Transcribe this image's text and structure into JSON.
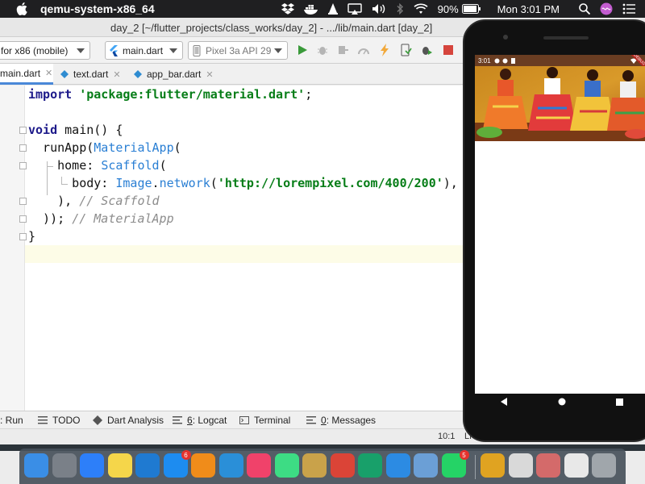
{
  "menubar": {
    "app_name": "qemu-system-x86_64",
    "battery": "90%",
    "clock": "Mon 3:01 PM"
  },
  "window": {
    "title": "day_2 [~/flutter_projects/class_works/day_2] - .../lib/main.dart [day_2]"
  },
  "toolbar": {
    "device_target": "for x86 (mobile)",
    "run_config": "main.dart",
    "emulator_device": "Pixel 3a API 29"
  },
  "tabs": [
    {
      "label": "main.dart",
      "active": true
    },
    {
      "label": "text.dart",
      "active": false
    },
    {
      "label": "app_bar.dart",
      "active": false
    }
  ],
  "editor": {
    "lines": [
      {
        "parts": [
          {
            "t": "import ",
            "c": "kw"
          },
          {
            "t": "'package:flutter/material.dart'",
            "c": "str"
          },
          {
            "t": ";",
            "c": ""
          }
        ]
      },
      {
        "parts": []
      },
      {
        "parts": [
          {
            "t": "void ",
            "c": "kw"
          },
          {
            "t": "main() {",
            "c": ""
          }
        ]
      },
      {
        "parts": [
          {
            "t": "  runApp(",
            "c": ""
          },
          {
            "t": "MaterialApp",
            "c": "cls"
          },
          {
            "t": "(",
            "c": ""
          }
        ]
      },
      {
        "parts": [
          {
            "t": "    home: ",
            "c": ""
          },
          {
            "t": "Scaffold",
            "c": "cls"
          },
          {
            "t": "(",
            "c": ""
          }
        ]
      },
      {
        "parts": [
          {
            "t": "      body: ",
            "c": ""
          },
          {
            "t": "Image",
            "c": "cls"
          },
          {
            "t": ".",
            "c": ""
          },
          {
            "t": "network",
            "c": "cls"
          },
          {
            "t": "(",
            "c": ""
          },
          {
            "t": "'http://lorempixel.com/400/200'",
            "c": "str"
          },
          {
            "t": "),",
            "c": ""
          }
        ]
      },
      {
        "parts": [
          {
            "t": "    ), ",
            "c": ""
          },
          {
            "t": "// Scaffold",
            "c": "cmt"
          }
        ]
      },
      {
        "parts": [
          {
            "t": "  )); ",
            "c": ""
          },
          {
            "t": "// MaterialApp",
            "c": "cmt"
          }
        ]
      },
      {
        "parts": [
          {
            "t": "}",
            "c": ""
          }
        ]
      }
    ]
  },
  "toolwindows": {
    "run": ": Run",
    "todo": "TODO",
    "dart_analysis": "Dart Analysis",
    "logcat_num": "6",
    "logcat": ": Logcat",
    "terminal": "Terminal",
    "messages_num": "0",
    "messages": ": Messages"
  },
  "statusbar": {
    "caret": "10:1",
    "line_sep": "LF"
  },
  "emulator": {
    "status_time": "3:01",
    "debug_banner": "DEBUG"
  },
  "dock": {
    "apps": [
      {
        "name": "finder-icon",
        "color": "#3a8ee6"
      },
      {
        "name": "launchpad-icon",
        "color": "#7a8088"
      },
      {
        "name": "safari-icon",
        "color": "#2d7ff9"
      },
      {
        "name": "notes-icon",
        "color": "#f5d64a"
      },
      {
        "name": "vscode-icon",
        "color": "#1f7ad1"
      },
      {
        "name": "app-store-icon",
        "color": "#1d8cf0",
        "badge": "6"
      },
      {
        "name": "vlc-icon",
        "color": "#f08c1a"
      },
      {
        "name": "edge-icon",
        "color": "#2a8fd8"
      },
      {
        "name": "music-icon",
        "color": "#f0426a"
      },
      {
        "name": "android-studio-icon",
        "color": "#3ddc84"
      },
      {
        "name": "database-icon",
        "color": "#c9a24a"
      },
      {
        "name": "chrome-icon",
        "color": "#db4437"
      },
      {
        "name": "tablet-icon",
        "color": "#18a06a"
      },
      {
        "name": "xcode-icon",
        "color": "#2c8be3"
      },
      {
        "name": "preview-icon",
        "color": "#6b9fd6"
      },
      {
        "name": "whatsapp-icon",
        "color": "#25d366",
        "badge": "5"
      },
      {
        "name": "wps-icon",
        "color": "#e0a321"
      },
      {
        "name": "screenshot-icon",
        "color": "#d9d9d9"
      },
      {
        "name": "photos-icon",
        "color": "#d46a6a"
      },
      {
        "name": "document-icon",
        "color": "#e8e8e8"
      },
      {
        "name": "trash-icon",
        "color": "#a0a6ab"
      }
    ]
  }
}
